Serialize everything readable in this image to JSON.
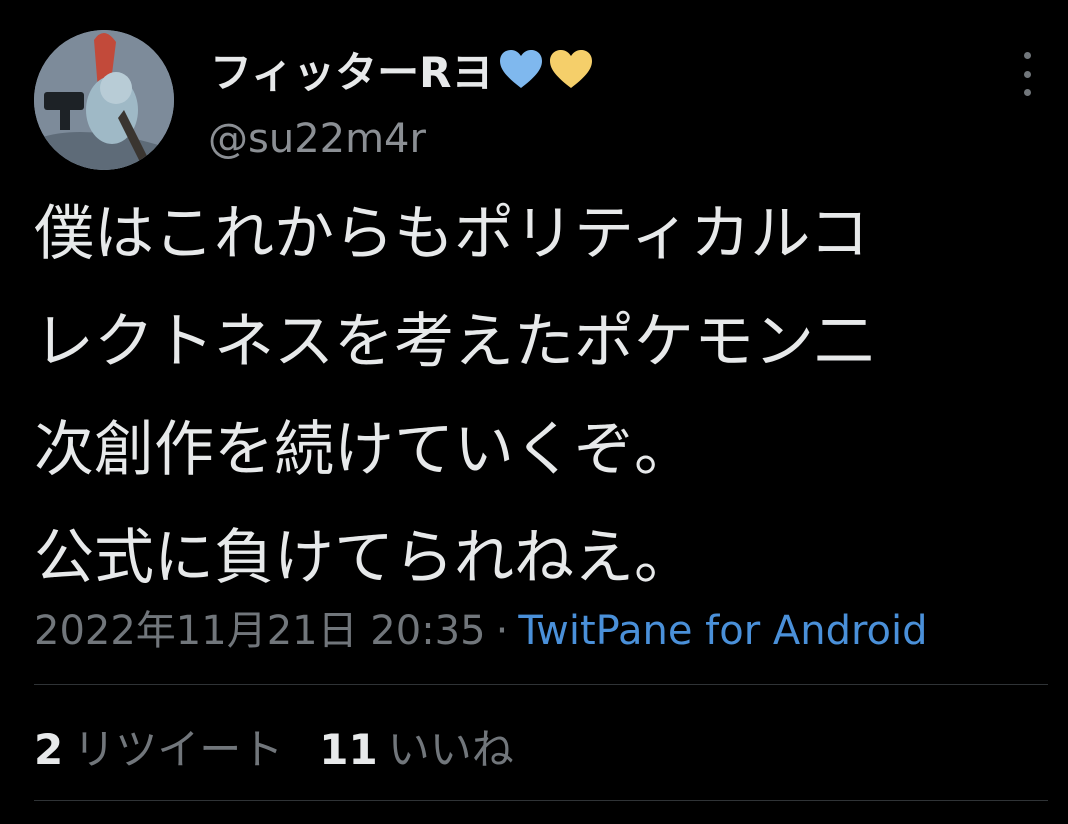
{
  "user": {
    "display_name": "フィッターRヨ",
    "handle": "@su22m4r",
    "name_icons": [
      "blue-heart-icon",
      "yellow-heart-icon"
    ],
    "heart_colors": [
      "#7fb8ee",
      "#f5cf6a"
    ]
  },
  "tweet": {
    "lines": [
      "僕はこれからもポリティカルコ",
      "レクトネスを考えたポケモン二",
      "次創作を続けていくぞ。",
      "公式に負けてられねえ。"
    ],
    "timestamp": "2022年11月21日 20:35",
    "separator": "·",
    "source": "TwitPane for Android"
  },
  "stats": {
    "retweets_count": "2",
    "retweets_label": "リツイート",
    "likes_count": "11",
    "likes_label": "いいね"
  },
  "icons": {
    "more": "more-vertical-icon",
    "avatar": "avatar"
  },
  "colors": {
    "background": "#000000",
    "text": "#e7e9ea",
    "secondary": "#71767b",
    "link": "#4a90d9",
    "divider": "#2f3336"
  }
}
